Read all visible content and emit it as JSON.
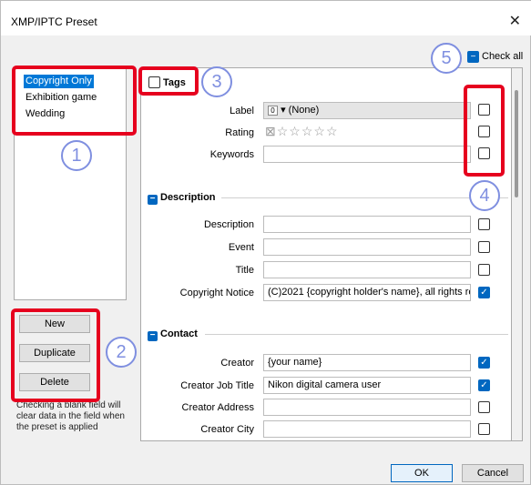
{
  "window": {
    "title": "XMP/IPTC Preset"
  },
  "presets": [
    "Copyright Only",
    "Exhibition game",
    "Wedding"
  ],
  "buttons": {
    "new": "New",
    "duplicate": "Duplicate",
    "delete": "Delete",
    "ok": "OK",
    "cancel": "Cancel"
  },
  "note": "Checking a blank field will clear data in the field when the preset is applied",
  "check_all": "Check all",
  "tags": {
    "title": "Tags",
    "label": {
      "name": "Label",
      "value": "(None)",
      "prefix": "0"
    },
    "rating": {
      "name": "Rating"
    },
    "keywords": {
      "name": "Keywords",
      "value": ""
    }
  },
  "description": {
    "title": "Description",
    "fields": [
      {
        "name": "Description",
        "value": "",
        "checked": false
      },
      {
        "name": "Event",
        "value": "",
        "checked": false
      },
      {
        "name": "Title",
        "value": "",
        "checked": false
      },
      {
        "name": "Copyright Notice",
        "value": "(C)2021 {copyright holder's name}, all rights re",
        "checked": true
      }
    ]
  },
  "contact": {
    "title": "Contact",
    "fields": [
      {
        "name": "Creator",
        "value": "{your name}",
        "checked": true
      },
      {
        "name": "Creator Job Title",
        "value": "Nikon digital camera user",
        "checked": true
      },
      {
        "name": "Creator Address",
        "value": "",
        "checked": false
      },
      {
        "name": "Creator City",
        "value": "",
        "checked": false
      }
    ]
  },
  "callouts": [
    "1",
    "2",
    "3",
    "4",
    "5"
  ],
  "colors": {
    "accent": "#0067c0",
    "highlight": "#e6001e",
    "callout": "#7f8fe0",
    "selection": "#0078d7"
  }
}
